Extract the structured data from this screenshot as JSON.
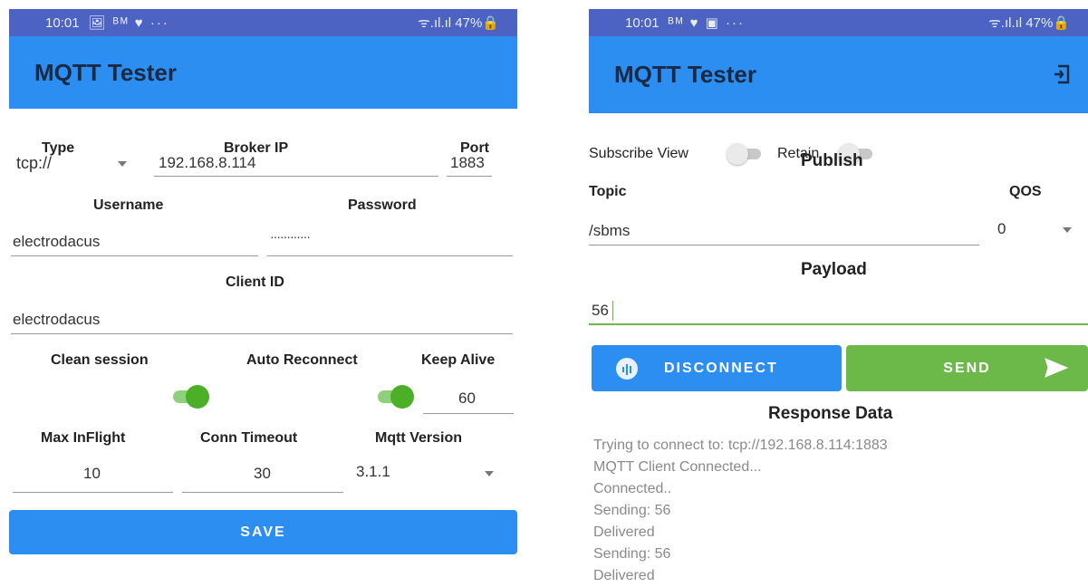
{
  "left": {
    "status": {
      "time": "10:01",
      "icons": "🖼 ᴮᴹ ♥ ···",
      "right": "ᯤ.ıl.ıl 47%🔒"
    },
    "title": "MQTT Tester",
    "labels": {
      "type": "Type",
      "broker_ip": "Broker IP",
      "port": "Port",
      "username": "Username",
      "password": "Password",
      "client_id": "Client ID",
      "clean_session": "Clean session",
      "auto_reconnect": "Auto Reconnect",
      "keep_alive": "Keep Alive",
      "max_inflight": "Max InFlight",
      "conn_timeout": "Conn Timeout",
      "mqtt_version": "Mqtt Version"
    },
    "values": {
      "type": "tcp://",
      "broker_ip": "192.168.8.114",
      "port": "1883",
      "username": "electrodacus",
      "password": "············",
      "client_id": "electrodacus",
      "keep_alive": "60",
      "max_inflight": "10",
      "conn_timeout": "30",
      "mqtt_version": "3.1.1"
    },
    "toggles": {
      "clean_session": true,
      "auto_reconnect": true
    },
    "save_label": "SAVE"
  },
  "right": {
    "status": {
      "time": "10:01",
      "icons": "ᴮᴹ ♥ ▣ ···",
      "right": "ᯤ.ıl.ıl 47%🔒"
    },
    "title": "MQTT Tester",
    "subscribe_view_label": "Subscribe View",
    "retain_label": "Retain",
    "toggles": {
      "subscribe_view": false,
      "retain": false
    },
    "publish_heading": "Publish",
    "topic_label": "Topic",
    "qos_label": "QOS",
    "topic_value": "/sbms",
    "qos_value": "0",
    "payload_heading": "Payload",
    "payload_value": "56",
    "disconnect_label": "DISCONNECT",
    "send_label": "SEND",
    "response_heading": "Response Data",
    "response_lines": [
      "Trying to connect to: tcp://192.168.8.114:1883",
      "MQTT Client Connected...",
      "Connected..",
      "Sending: 56",
      "Delivered",
      "Sending: 56",
      "Delivered"
    ]
  },
  "colors": {
    "statusbar": "#4d63c4",
    "appbar": "#2b8ef0",
    "save": "#2b8ef0",
    "disconnect": "#2b8ef0",
    "send": "#6cb94a",
    "toggle_on": "#4caf28"
  }
}
